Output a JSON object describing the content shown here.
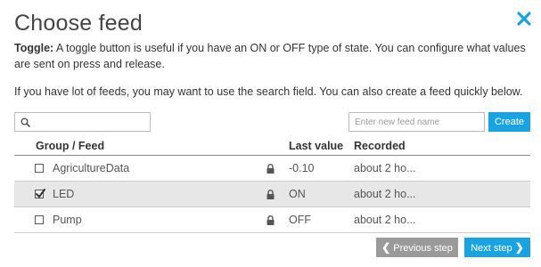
{
  "dialog": {
    "title": "Choose feed",
    "description_label": "Toggle:",
    "description_text": " A toggle button is useful if you have an ON or OFF type of state. You can configure what values are sent on press and release.",
    "hint": "If you have lot of feeds, you may want to use the search field. You can also create a feed quickly below."
  },
  "search": {
    "value": "",
    "placeholder": ""
  },
  "new_feed": {
    "value": "",
    "placeholder": "Enter new feed name"
  },
  "create_label": "Create",
  "table": {
    "columns": [
      "Group / Feed",
      "Last value",
      "Recorded"
    ],
    "rows": [
      {
        "name": "AgricultureData",
        "last_value": "-0.10",
        "recorded": "about 2 ho...",
        "checked": false,
        "locked": true
      },
      {
        "name": "LED",
        "last_value": "ON",
        "recorded": "about 2 ho...",
        "checked": true,
        "locked": true
      },
      {
        "name": "Pump",
        "last_value": "OFF",
        "recorded": "about 2 ho...",
        "checked": false,
        "locked": true
      }
    ]
  },
  "footer": {
    "prev_label": "Previous step",
    "next_label": "Next step"
  },
  "colors": {
    "accent": "#1aa3e1",
    "secondary_button": "#9a9a9a",
    "selected_row": "#e7e7e7"
  },
  "icons": {
    "close": "close-icon",
    "search": "search-icon",
    "lock": "lock-icon",
    "checkbox": "checkmark-icon"
  }
}
